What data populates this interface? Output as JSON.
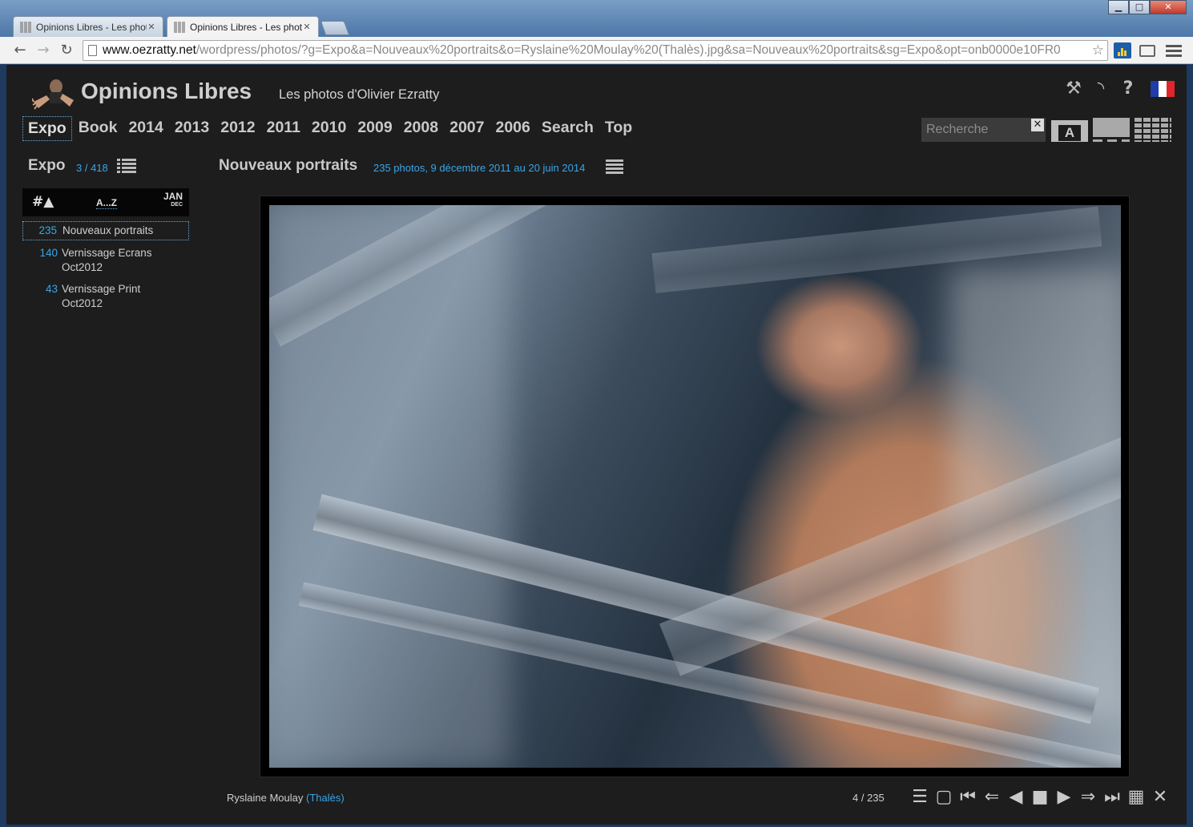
{
  "browser": {
    "tabs": [
      {
        "label": "Opinions Libres - Les phot",
        "active": false
      },
      {
        "label": "Opinions Libres - Les phot",
        "active": true
      }
    ],
    "url_host": "www.oezratty.net",
    "url_rest": "/wordpress/photos/?g=Expo&a=Nouveaux%20portraits&o=Ryslaine%20Moulay%20(Thalès).jpg&sa=Nouveaux%20portraits&sg=Expo&opt=onb0000e10FR0"
  },
  "header": {
    "site_title": "Opinions Libres",
    "site_subtitle": "Les photos d'Olivier Ezratty",
    "icons": [
      "tools-icon",
      "rss-icon",
      "help-icon",
      "french-flag-icon"
    ]
  },
  "nav": {
    "items": [
      "Expo",
      "Book",
      "2014",
      "2013",
      "2012",
      "2011",
      "2010",
      "2009",
      "2008",
      "2007",
      "2006",
      "Search",
      "Top"
    ],
    "current": "Expo"
  },
  "search": {
    "placeholder": "Recherche"
  },
  "view_modes": [
    "text-view-icon",
    "full-view-icon",
    "grid-view-icon"
  ],
  "sidebar": {
    "title": "Expo",
    "count": "3 / 418",
    "sort": {
      "by_count": "#▲",
      "alpha": "A...Z",
      "date_top": "JAN",
      "date_bottom": "DEC"
    },
    "albums": [
      {
        "count": "235",
        "name": "Nouveaux portraits",
        "current": true
      },
      {
        "count": "140",
        "name": "Vernissage Ecrans Oct2012",
        "current": false
      },
      {
        "count": "43",
        "name": "Vernissage Print Oct2012",
        "current": false
      }
    ]
  },
  "gallery": {
    "title": "Nouveaux portraits",
    "subtitle": "235 photos, 9 décembre 2011 au 20 juin 2014"
  },
  "photo": {
    "caption_name": "Ryslaine Moulay",
    "caption_org": "(Thalès)",
    "counter": "4 / 235"
  },
  "controls": [
    "list-icon",
    "stop-icon",
    "first-icon",
    "prev-fast-icon",
    "prev-icon",
    "pause-icon",
    "next-icon",
    "next-fast-icon",
    "last-icon",
    "grid-icon",
    "fullscreen-icon"
  ],
  "colors": {
    "accent": "#39a5e8",
    "background": "#1d1d1d",
    "text": "#c9c9c9"
  }
}
